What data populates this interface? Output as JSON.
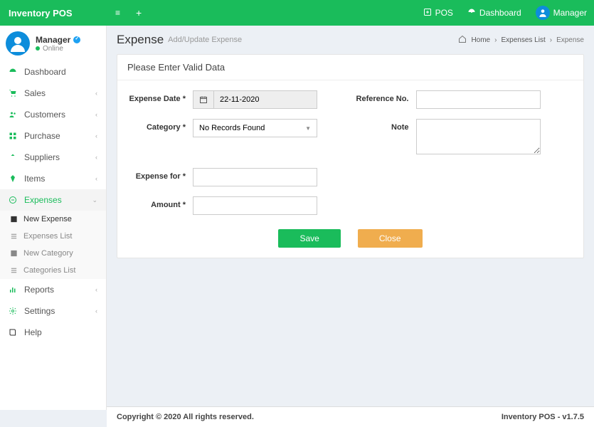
{
  "brand": "Inventory POS",
  "topbar": {
    "pos": "POS",
    "dashboard": "Dashboard",
    "user": "Manager"
  },
  "user": {
    "name": "Manager",
    "status": "Online"
  },
  "nav": {
    "dashboard": "Dashboard",
    "sales": "Sales",
    "customers": "Customers",
    "purchase": "Purchase",
    "suppliers": "Suppliers",
    "items": "Items",
    "expenses": "Expenses",
    "reports": "Reports",
    "settings": "Settings",
    "help": "Help"
  },
  "subnav": {
    "new_expense": "New Expense",
    "expenses_list": "Expenses List",
    "new_category": "New Category",
    "categories_list": "Categories List"
  },
  "page": {
    "title": "Expense",
    "subtitle": "Add/Update Expense",
    "box_title": "Please Enter Valid Data"
  },
  "breadcrumb": {
    "home": "Home",
    "list": "Expenses List",
    "current": "Expense"
  },
  "form": {
    "labels": {
      "date": "Expense Date *",
      "category": "Category *",
      "expense_for": "Expense for *",
      "amount": "Amount *",
      "reference": "Reference No.",
      "note": "Note"
    },
    "values": {
      "date": "22-11-2020",
      "category_placeholder": "No Records Found"
    },
    "buttons": {
      "save": "Save",
      "close": "Close"
    }
  },
  "footer": {
    "left": "Copyright © 2020 All rights reserved.",
    "right": "Inventory POS - v1.7.5"
  }
}
